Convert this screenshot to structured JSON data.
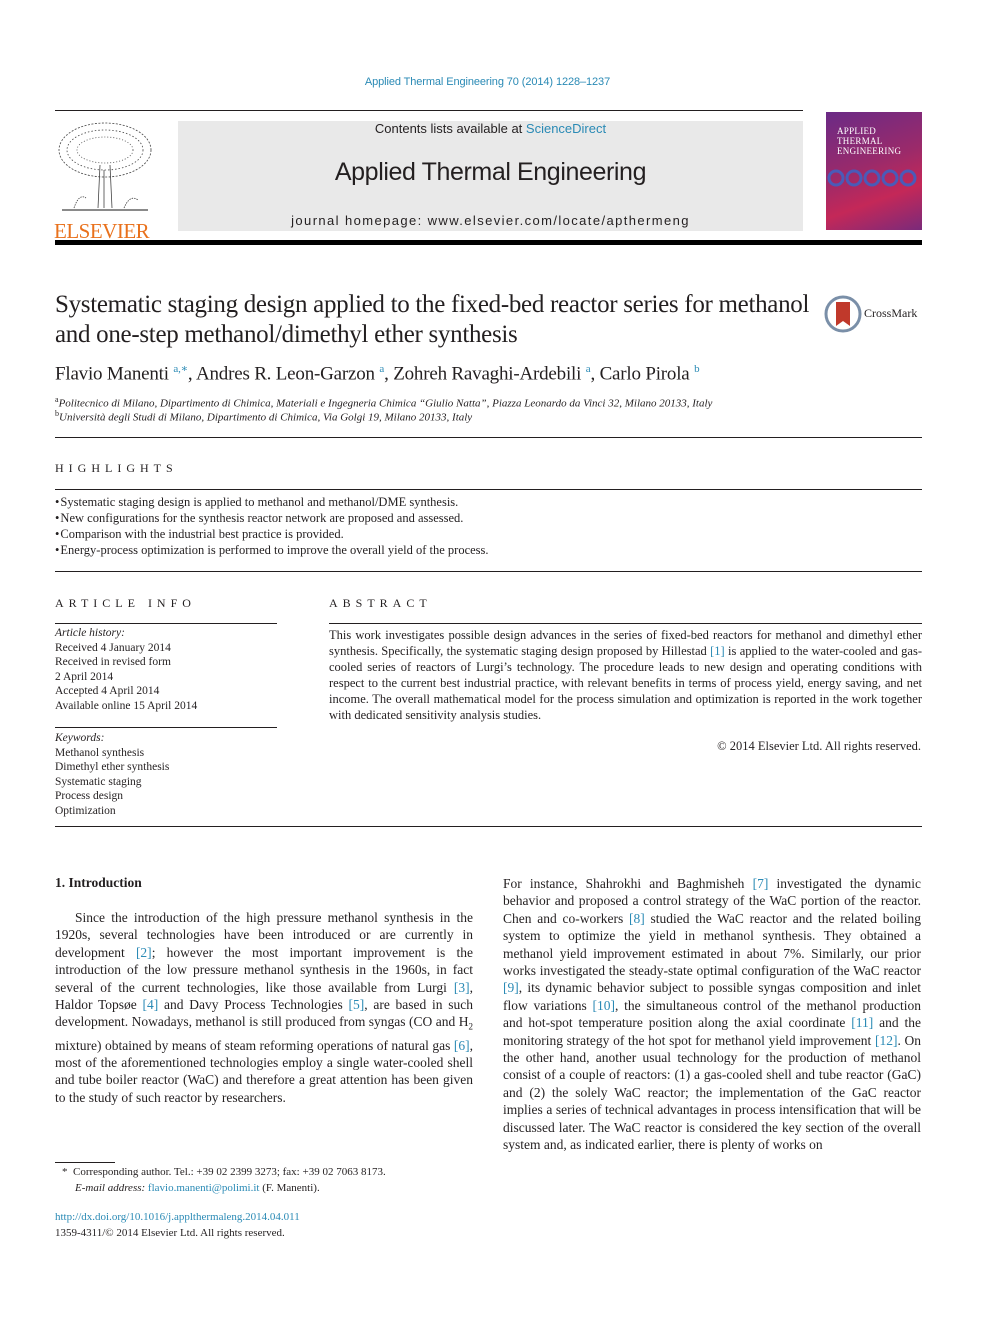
{
  "journal_ref": "Applied Thermal Engineering 70 (2014) 1228–1237",
  "header": {
    "publisher_logo_text": "ELSEVIER",
    "contents_prefix": "Contents lists available at ",
    "contents_link": "ScienceDirect",
    "journal_name": "Applied Thermal Engineering",
    "homepage": "journal homepage: www.elsevier.com/locate/apthermeng",
    "cover_title_lines": [
      "APPLIED",
      "THERMAL",
      "ENGINEERING"
    ]
  },
  "article": {
    "title": "Systematic staging design applied to the fixed-bed reactor series for methanol and one-step methanol/dimethyl ether synthesis",
    "crossmark_label": "CrossMark",
    "authors": [
      {
        "name": "Flavio Manenti",
        "sup": "a,∗"
      },
      {
        "name": "Andres R. Leon-Garzon",
        "sup": "a"
      },
      {
        "name": "Zohreh Ravaghi-Ardebili",
        "sup": "a"
      },
      {
        "name": "Carlo Pirola",
        "sup": "b"
      }
    ],
    "affiliations": [
      {
        "key": "a",
        "text": "Politecnico di Milano, Dipartimento di Chimica, Materiali e Ingegneria Chimica “Giulio Natta”, Piazza Leonardo da Vinci 32, Milano 20133, Italy"
      },
      {
        "key": "b",
        "text": "Università degli Studi di Milano, Dipartimento di Chimica, Via Golgi 19, Milano 20133, Italy"
      }
    ]
  },
  "highlights": {
    "heading": "HIGHLIGHTS",
    "items": [
      "Systematic staging design is applied to methanol and methanol/DME synthesis.",
      "New configurations for the synthesis reactor network are proposed and assessed.",
      "Comparison with the industrial best practice is provided.",
      "Energy-process optimization is performed to improve the overall yield of the process."
    ]
  },
  "article_info": {
    "heading": "ARTICLE INFO",
    "history_label": "Article history:",
    "history": [
      "Received 4 January 2014",
      "Received in revised form",
      "2 April 2014",
      "Accepted 4 April 2014",
      "Available online 15 April 2014"
    ],
    "keywords_label": "Keywords:",
    "keywords": [
      "Methanol synthesis",
      "Dimethyl ether synthesis",
      "Systematic staging",
      "Process design",
      "Optimization"
    ]
  },
  "abstract": {
    "heading": "ABSTRACT",
    "text_before_ref": "This work investigates possible design advances in the series of fixed-bed reactors for methanol and dimethyl ether synthesis. Specifically, the systematic staging design proposed by Hillestad ",
    "ref": "[1]",
    "text_after_ref": " is applied to the water-cooled and gas-cooled series of reactors of Lurgi’s technology. The procedure leads to new design and operating conditions with respect to the current best industrial practice, with relevant benefits in terms of process yield, energy saving, and net income. The overall mathematical model for the process simulation and optimization is reported in the work together with dedicated sensitivity analysis studies.",
    "copyright": "© 2014 Elsevier Ltd. All rights reserved."
  },
  "intro": {
    "heading": "1.  Introduction",
    "left": {
      "s1": "Since the introduction of the high pressure methanol synthesis in the 1920s, several technologies have been introduced or are currently in development ",
      "r2": "[2]",
      "s2": "; however the most important improvement is the introduction of the low pressure methanol synthesis in the 1960s, in fact several of the current technologies, like those available from Lurgi ",
      "r3": "[3]",
      "s3": ", Haldor Topsøe ",
      "r4": "[4]",
      "s4": " and Davy Process Technologies ",
      "r5": "[5]",
      "s5": ", are based in such development. Nowadays, methanol is still produced from syngas (CO and H",
      "sub": "2",
      "s6": " mixture) obtained by means of steam reforming operations of natural gas ",
      "r6": "[6]",
      "s7": ", most of the aforementioned technologies employ a single water-cooled shell and tube boiler reactor (WaC) and therefore a great attention has been given to the study of such reactor by researchers."
    },
    "right": {
      "s1": "For instance, Shahrokhi and Baghmisheh ",
      "r7": "[7]",
      "s2": " investigated the dynamic behavior and proposed a control strategy of the WaC portion of the reactor. Chen and co-workers ",
      "r8": "[8]",
      "s3": " studied the WaC reactor and the related boiling system to optimize the yield in methanol synthesis. They obtained a methanol yield improvement estimated in about 7%. Similarly, our prior works investigated the steady-state optimal configuration of the WaC reactor ",
      "r9": "[9]",
      "s4": ", its dynamic behavior subject to possible syngas composition and inlet flow variations ",
      "r10": "[10]",
      "s5": ", the simultaneous control of the methanol production and hot-spot temperature position along the axial coordinate ",
      "r11": "[11]",
      "s6": " and the monitoring strategy of the hot spot for methanol yield improvement ",
      "r12": "[12]",
      "s7": ". On the other hand, another usual technology for the production of methanol consist of a couple of reactors: (1) a gas-cooled shell and tube reactor (GaC) and (2) the solely WaC reactor; the implementation of the GaC reactor implies a series of technical advantages in process intensification that will be discussed later. The WaC reactor is considered the key section of the overall system and, as indicated earlier, there is plenty of works on"
    }
  },
  "footnote": {
    "marker": "*",
    "corresponding": "Corresponding author. Tel.: +39 02 2399 3273; fax: +39 02 7063 8173.",
    "email_label": "E-mail address:",
    "email": "flavio.manenti@polimi.it",
    "email_suffix": " (F. Manenti).",
    "doi": "http://dx.doi.org/10.1016/j.applthermaleng.2014.04.011",
    "issn": "1359-4311/© 2014 Elsevier Ltd. All rights reserved."
  },
  "colors": {
    "link": "#2a8ab5",
    "elsevier_orange": "#e9711c",
    "header_gray": "#e9e9e9"
  }
}
